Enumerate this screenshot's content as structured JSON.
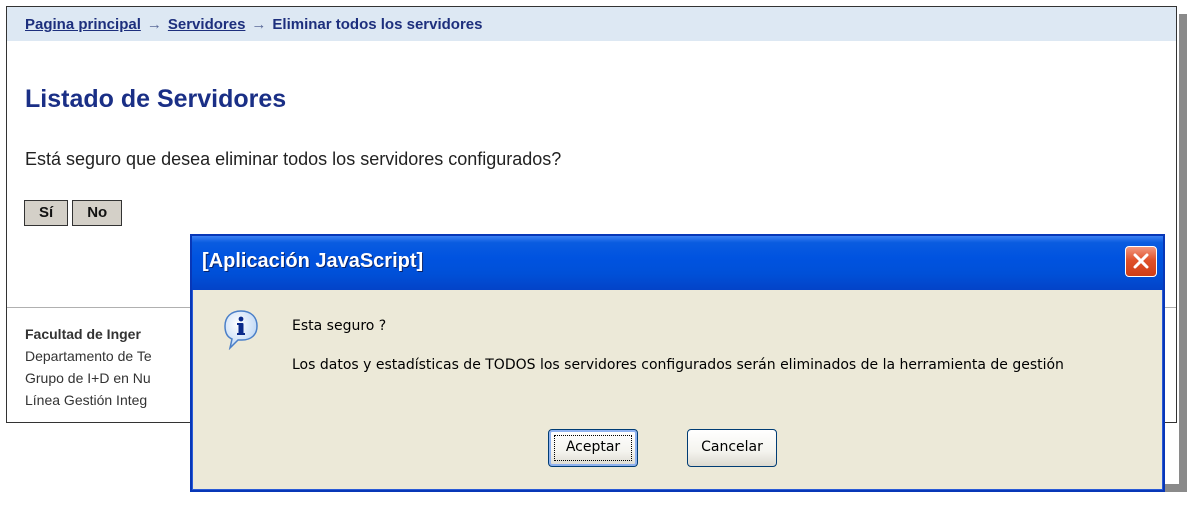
{
  "breadcrumb": {
    "items": [
      "Pagina principal",
      "Servidores"
    ],
    "current": "Eliminar todos los servidores",
    "separator": "→"
  },
  "main": {
    "title": "Listado de Servidores",
    "question": "Está seguro que desea eliminar todos los servidores configurados?",
    "yes_label": "Sí",
    "no_label": "No"
  },
  "footer": {
    "line1": "Facultad de Inger",
    "line2": "Departamento de Te",
    "line3": "Grupo de I+D en Nu",
    "line4": "Línea Gestión Integ"
  },
  "dialog": {
    "title": "[Aplicación JavaScript]",
    "message_title": "Esta seguro ?",
    "message_body": "Los datos y estadísticas de TODOS los servidores configurados serán eliminados de la herramienta de gestión",
    "ok_label": "Aceptar",
    "cancel_label": "Cancelar",
    "icon": "info-icon",
    "close_icon": "close-icon"
  },
  "colors": {
    "breadcrumb_bg": "#dde8f3",
    "link": "#1d2f7d",
    "title": "#1a2f86",
    "dialog_bg": "#ece9d8",
    "titlebar": "#0053e0",
    "close": "#e0522b"
  }
}
